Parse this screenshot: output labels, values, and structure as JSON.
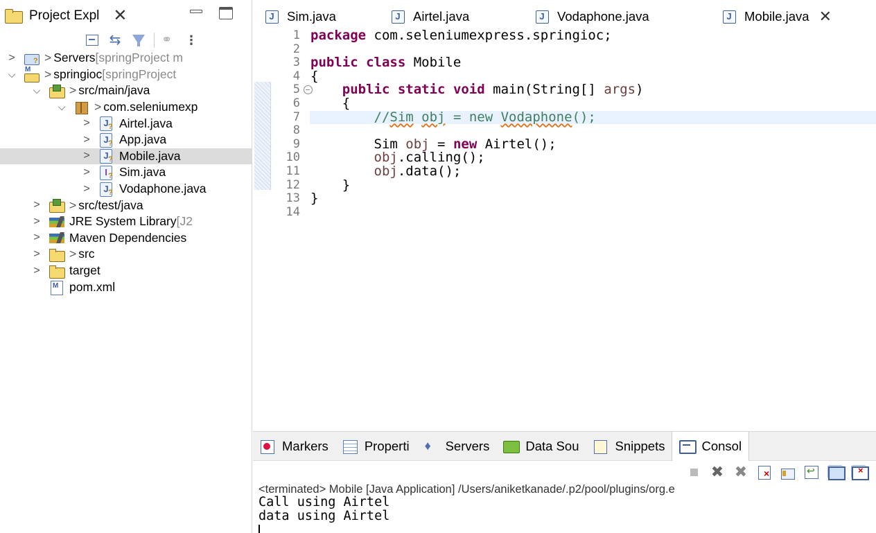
{
  "explorer": {
    "tab_title": "Project Expl",
    "close": "✕",
    "tree": [
      {
        "indent": 0,
        "chevron": ">",
        "icon": "server-project-icon",
        "decorator": "> ",
        "label": "Servers",
        "suffix": " [springProject m"
      },
      {
        "indent": 0,
        "chevron": "v",
        "icon": "maven-project-icon",
        "decorator": "> ",
        "label": "springioc",
        "suffix": " [springProject"
      },
      {
        "indent": 1,
        "chevron": "v",
        "icon": "source-folder-icon",
        "decorator": "> ",
        "label": "src/main/java",
        "suffix": ""
      },
      {
        "indent": 2,
        "chevron": "v",
        "icon": "package-icon",
        "decorator": " > ",
        "label": "com.seleniumexp",
        "suffix": ""
      },
      {
        "indent": 3,
        "chevron": ">",
        "icon": "java-file-icon",
        "decorator": "",
        "label": "Airtel.java",
        "suffix": ""
      },
      {
        "indent": 3,
        "chevron": ">",
        "icon": "java-file-icon",
        "decorator": "",
        "label": "App.java",
        "suffix": ""
      },
      {
        "indent": 3,
        "chevron": ">",
        "icon": "java-file-icon",
        "decorator": "",
        "label": "Mobile.java",
        "suffix": "",
        "selected": true
      },
      {
        "indent": 3,
        "chevron": ">",
        "icon": "interface-file-icon",
        "decorator": "",
        "label": "Sim.java",
        "suffix": ""
      },
      {
        "indent": 3,
        "chevron": ">",
        "icon": "java-file-icon",
        "decorator": "",
        "label": "Vodaphone.java",
        "suffix": ""
      },
      {
        "indent": 1,
        "chevron": ">",
        "icon": "source-folder-icon",
        "decorator": "> ",
        "label": "src/test/java",
        "suffix": ""
      },
      {
        "indent": 1,
        "chevron": ">",
        "icon": "library-icon",
        "decorator": "",
        "label": "JRE System Library",
        "suffix": " [J2"
      },
      {
        "indent": 1,
        "chevron": ">",
        "icon": "library-icon",
        "decorator": "",
        "label": "Maven Dependencies",
        "suffix": ""
      },
      {
        "indent": 1,
        "chevron": ">",
        "icon": "folder-icon",
        "decorator": "> ",
        "label": "src",
        "suffix": ""
      },
      {
        "indent": 1,
        "chevron": ">",
        "icon": "folder-icon",
        "decorator": "",
        "label": "target",
        "suffix": ""
      },
      {
        "indent": 1,
        "chevron": "",
        "icon": "xml-file-icon",
        "decorator": "",
        "label": "pom.xml",
        "suffix": ""
      }
    ]
  },
  "editor": {
    "tabs": [
      {
        "label": "Sim.java",
        "active": false
      },
      {
        "label": "Airtel.java",
        "active": false
      },
      {
        "label": "Vodaphone.java",
        "active": false
      },
      {
        "label": "Mobile.java",
        "active": true
      }
    ],
    "close": "✕",
    "line_numbers": [
      "1",
      "2",
      "3",
      "4",
      "5",
      "6",
      "7",
      "8",
      "9",
      "10",
      "11",
      "12",
      "13",
      "14"
    ],
    "code": [
      [
        {
          "t": "package",
          "c": "kw"
        },
        {
          "t": " com.seleniumexpress.springioc;"
        }
      ],
      [],
      [
        {
          "t": "public",
          "c": "kw"
        },
        {
          "t": " "
        },
        {
          "t": "class",
          "c": "kw"
        },
        {
          "t": " Mobile"
        }
      ],
      [
        {
          "t": "{"
        }
      ],
      [
        {
          "t": "    "
        },
        {
          "t": "public",
          "c": "kw"
        },
        {
          "t": " "
        },
        {
          "t": "static",
          "c": "kw"
        },
        {
          "t": " "
        },
        {
          "t": "void",
          "c": "kw"
        },
        {
          "t": " main(String[] "
        },
        {
          "t": "args",
          "c": "var"
        },
        {
          "t": ")"
        }
      ],
      [
        {
          "t": "    {"
        }
      ],
      [
        {
          "t": "        //",
          "c": "cm"
        },
        {
          "t": "Sim",
          "c": "cm squig"
        },
        {
          "t": " ",
          "c": "cm"
        },
        {
          "t": "obj",
          "c": "cm squig"
        },
        {
          "t": " = new ",
          "c": "cm"
        },
        {
          "t": "Vodaphone",
          "c": "cm squig"
        },
        {
          "t": "();",
          "c": "cm"
        }
      ],
      [],
      [
        {
          "t": "        Sim "
        },
        {
          "t": "obj",
          "c": "var"
        },
        {
          "t": " = "
        },
        {
          "t": "new",
          "c": "kw"
        },
        {
          "t": " Airtel();"
        }
      ],
      [
        {
          "t": "        "
        },
        {
          "t": "obj",
          "c": "var"
        },
        {
          "t": ".calling();"
        }
      ],
      [
        {
          "t": "        "
        },
        {
          "t": "obj",
          "c": "var"
        },
        {
          "t": ".data();"
        }
      ],
      [
        {
          "t": "    }"
        }
      ],
      [
        {
          "t": "}"
        }
      ],
      []
    ]
  },
  "console": {
    "tabs": [
      {
        "label": "Markers",
        "icon": "markers-icon"
      },
      {
        "label": "Properti",
        "icon": "properties-icon"
      },
      {
        "label": "Servers",
        "icon": "servers-icon"
      },
      {
        "label": "Data Sou",
        "icon": "data-source-icon"
      },
      {
        "label": "Snippets",
        "icon": "snippets-icon"
      },
      {
        "label": "Consol",
        "icon": "console-icon",
        "active": true
      }
    ],
    "status": "<terminated> Mobile [Java Application] /Users/aniketkanade/.p2/pool/plugins/org.e",
    "output": [
      "Call using Airtel",
      "data using Airtel"
    ]
  }
}
